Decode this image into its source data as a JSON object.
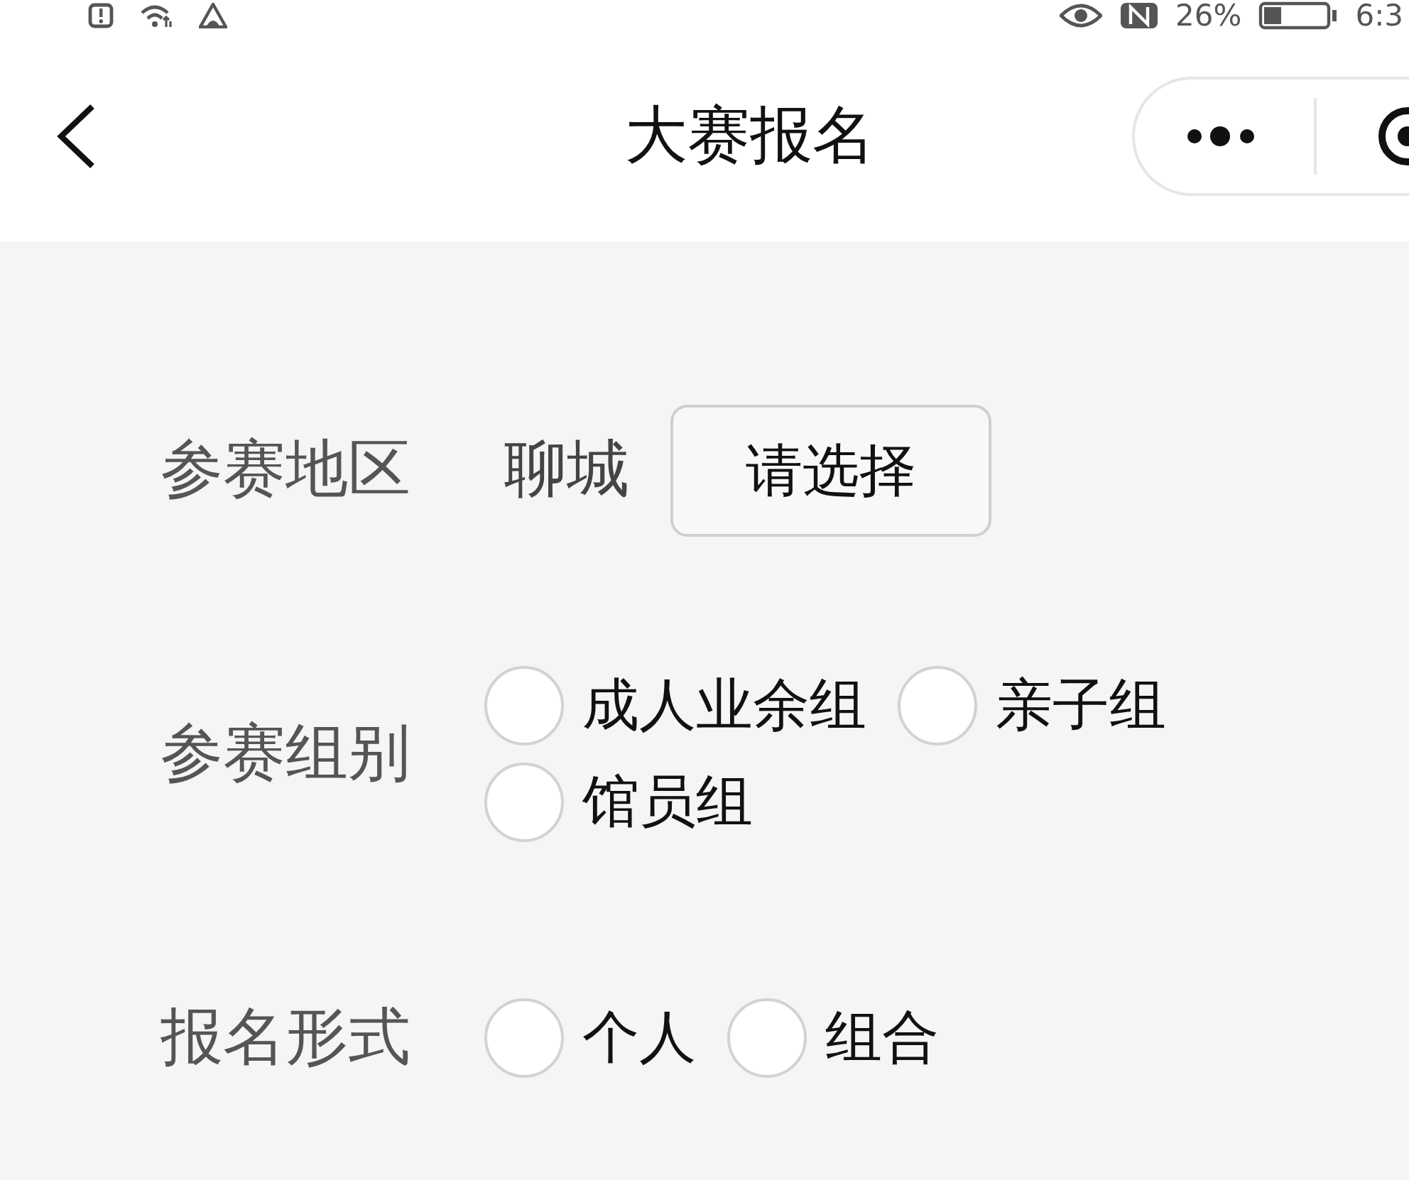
{
  "status_bar": {
    "battery_percent": "26%",
    "time": "6:3"
  },
  "nav_bar": {
    "title": "大赛报名"
  },
  "form": {
    "fields": [
      {
        "kind": "picker",
        "label": "参赛地区",
        "value": "聊城",
        "button": "请选择"
      },
      {
        "kind": "radio",
        "label": "参赛组别",
        "options": [
          {
            "label": "成人业余组",
            "selected": false
          },
          {
            "label": "亲子组",
            "selected": false
          },
          {
            "label": "馆员组",
            "selected": false
          }
        ]
      },
      {
        "kind": "radio",
        "label": "报名形式",
        "options": [
          {
            "label": "个人",
            "selected": false
          },
          {
            "label": "组合",
            "selected": false
          }
        ]
      }
    ]
  }
}
